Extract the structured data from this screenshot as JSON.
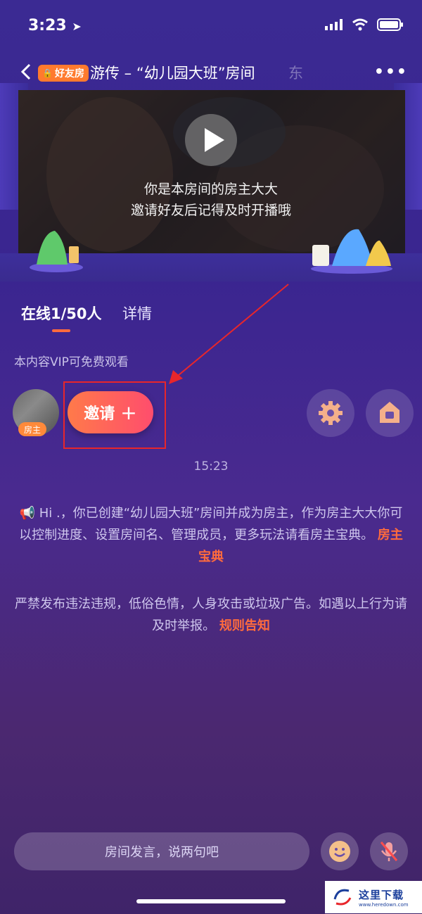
{
  "status_bar": {
    "time": "3:23"
  },
  "header": {
    "badge": "好友房",
    "title": "游传 – “幼儿园大班”房间",
    "title_overflow": "东"
  },
  "stage": {
    "message_line1": "你是本房间的房主大大",
    "message_line2": "邀请好友后记得及时开播哦"
  },
  "tabs": [
    {
      "label": "在线1/50人"
    },
    {
      "label": "详情"
    }
  ],
  "vip_note": "本内容VIP可免费观看",
  "host": {
    "tag": "房主"
  },
  "invite": {
    "label": "邀请",
    "plus": "+"
  },
  "chat": {
    "time": "15:23",
    "system_message": "Hi .，你已创建“幼儿园大班”房间并成为房主，作为房主大大你可以控制进度、设置房间名、管理成员，更多玩法请看房主宝典。",
    "system_link": "房主宝典",
    "rule_message": "严禁发布违法违规，低俗色情，人身攻击或垃圾广告。如遇以上行为请及时举报。",
    "rule_link": "规则告知"
  },
  "bottom_bar": {
    "input_placeholder": "房间发言，说两句吧"
  },
  "watermark": {
    "text": "这里下载",
    "sub": "www.heredown.com"
  },
  "colors": {
    "accent": "#ff6b3d",
    "invite_start": "#ff7a4a",
    "invite_end": "#ff4d6d",
    "badge": "#ff7a2e"
  }
}
